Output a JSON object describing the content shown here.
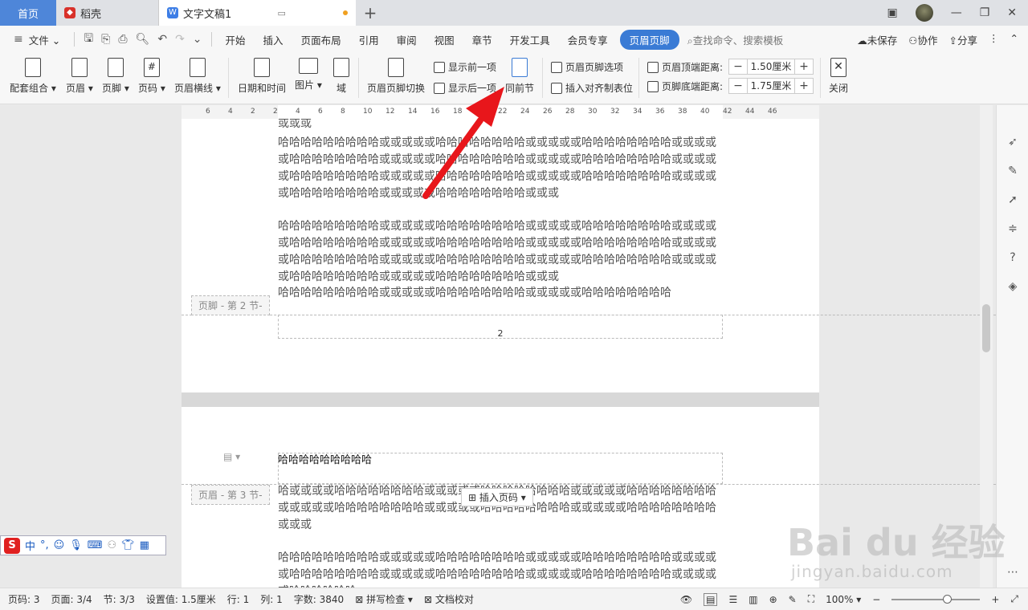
{
  "tabs": {
    "home": "首页",
    "daoke": "稻壳",
    "doc": "文字文稿1"
  },
  "menu": {
    "file": "文件",
    "items": [
      "开始",
      "插入",
      "页面布局",
      "引用",
      "审阅",
      "视图",
      "章节",
      "开发工具",
      "会员专享"
    ],
    "active": "页眉页脚",
    "search": "查找命令、搜索模板",
    "unsaved": "未保存",
    "collab": "协作",
    "share": "分享"
  },
  "ribbon": {
    "combo": "配套组合",
    "header": "页眉",
    "footer": "页脚",
    "pagenum": "页码",
    "header_line": "页眉横线",
    "datetime": "日期和时间",
    "picture": "图片",
    "field": "域",
    "switch": "页眉页脚切换",
    "show_prev": "显示前一项",
    "show_next": "显示后一项",
    "same_prev": "同前节",
    "options": "页眉页脚选项",
    "insert_align_tab": "插入对齐制表位",
    "header_top_label": "页眉顶端距离:",
    "header_top_value": "1.50厘米",
    "footer_bottom_label": "页脚底端距离:",
    "footer_bottom_value": "1.75厘米",
    "close": "关闭"
  },
  "ruler_ticks": [
    "6",
    "4",
    "2",
    "2",
    "4",
    "6",
    "8",
    "10",
    "12",
    "14",
    "16",
    "18",
    "20",
    "22",
    "24",
    "26",
    "28",
    "30",
    "32",
    "34",
    "36",
    "38",
    "40",
    "42",
    "44",
    "46"
  ],
  "page2": {
    "top_fragment": "或或或",
    "paragraphs": [
      "哈哈哈哈哈哈哈哈哈或或或或或哈哈哈哈哈哈哈哈或或或或或哈哈哈哈哈哈哈哈或或或或或哈哈哈哈哈哈哈哈或或或或或哈哈哈哈哈哈哈哈或或或或或哈哈哈哈哈哈哈哈或或或或或哈哈哈哈哈哈哈哈或或或或或哈哈哈哈哈哈哈哈或或或或或哈哈哈哈哈哈哈哈或或或或或哈哈哈哈哈哈哈哈或或或或或哈哈哈哈哈哈哈哈或或或",
      "哈哈哈哈哈哈哈哈哈或或或或或哈哈哈哈哈哈哈哈或或或或或哈哈哈哈哈哈哈哈或或或或或哈哈哈哈哈哈哈哈或或或或或哈哈哈哈哈哈哈哈或或或或或哈哈哈哈哈哈哈哈或或或或或哈哈哈哈哈哈哈哈或或或或或哈哈哈哈哈哈哈哈或或或或或哈哈哈哈哈哈哈哈或或或或或哈哈哈哈哈哈哈哈或或或或或哈哈哈哈哈哈哈哈或或或",
      "哈哈哈哈哈哈哈哈哈或或或或或哈哈哈哈哈哈哈哈或或或或或哈哈哈哈哈哈哈哈"
    ],
    "footer_label": "页脚 - 第 2 节-",
    "page_number": "2"
  },
  "page3": {
    "header_text": "哈哈哈哈哈哈哈哈哈",
    "header_label": "页眉 - 第 3 节-",
    "insert_page_number": "插入页码",
    "paragraphs": [
      "哈或或或或哈哈哈哈哈哈哈哈或或或或或哈哈哈哈哈哈哈哈或或或或或哈哈哈哈哈哈哈哈或或或或或哈哈哈哈哈哈哈哈或或或或或哈哈哈哈哈哈哈哈或或或或或哈哈哈哈哈哈哈哈或或或",
      "哈哈哈哈哈哈哈哈哈或或或或或哈哈哈哈哈哈哈哈或或或或或哈哈哈哈哈哈哈哈或或或或或哈哈哈哈哈哈哈哈或或或或或哈哈哈哈哈哈哈哈或或或或或哈哈哈哈哈哈哈哈或或或或或哈哈哈哈哈哈"
    ]
  },
  "ime": {
    "logo": "S",
    "lang": "中"
  },
  "status": {
    "page_no": "页码: 3",
    "pages": "页面: 3/4",
    "section": "节: 3/3",
    "setting": "设置值: 1.5厘米",
    "row": "行: 1",
    "col": "列: 1",
    "words": "字数: 3840",
    "spell": "拼写检查",
    "proof": "文档校对",
    "zoom": "100%"
  },
  "watermark": {
    "brand": "Bai du 经验",
    "url": "jingyan.baidu.com"
  },
  "colors": {
    "accent": "#3a7bd5",
    "home_tab": "#4e86d9",
    "arrow": "#e8161b"
  }
}
